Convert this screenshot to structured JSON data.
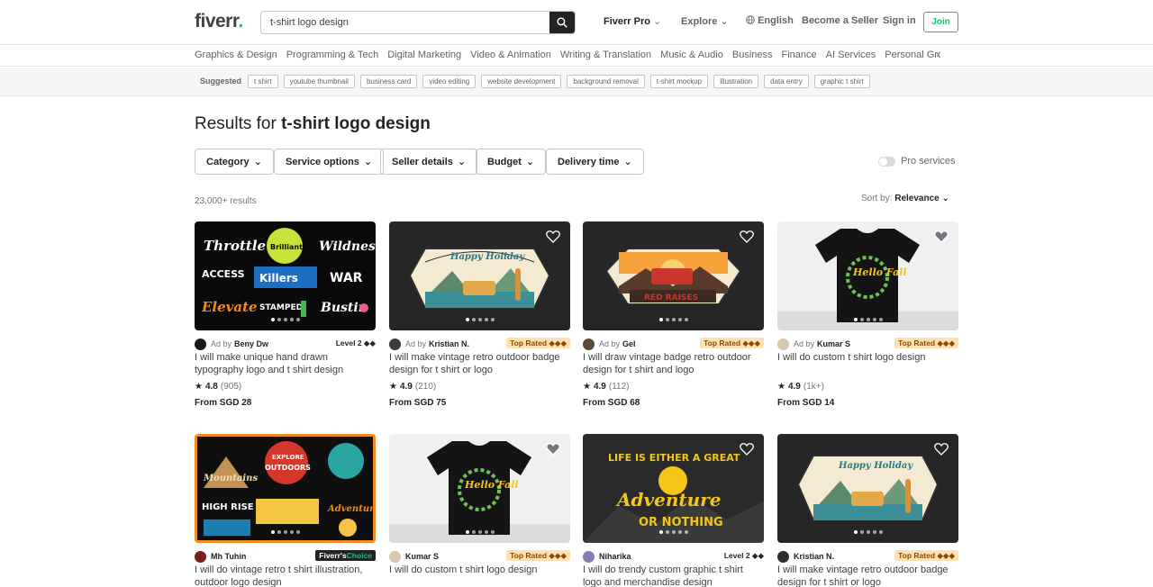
{
  "header": {
    "logo": "fiverr",
    "logo_dot": ".",
    "search_value": "t-shirt logo design",
    "nav": {
      "pro": "Fiverr Pro",
      "explore": "Explore",
      "language": "English",
      "become_seller": "Become a Seller",
      "sign_in": "Sign in",
      "join": "Join"
    }
  },
  "categories": [
    "Graphics & Design",
    "Programming & Tech",
    "Digital Marketing",
    "Video & Animation",
    "Writing & Translation",
    "Music & Audio",
    "Business",
    "Finance",
    "AI Services",
    "Personal Growth"
  ],
  "suggested": {
    "label": "Suggested",
    "tags": [
      "t shirt",
      "youtube thumbnail",
      "business card",
      "video editing",
      "website development",
      "background removal",
      "t-shirt mockup",
      "illustration",
      "data entry",
      "graphic t shirt"
    ]
  },
  "results": {
    "prefix": "Results for ",
    "query": "t-shirt logo design",
    "count": "23,000+ results",
    "sort_label": "Sort by:",
    "sort_value": "Relevance"
  },
  "filters": {
    "category": "Category",
    "service_options": "Service options",
    "seller_details": "Seller details",
    "budget": "Budget",
    "delivery_time": "Delivery time",
    "pro_services": "Pro services"
  },
  "gigs": [
    {
      "ad": "Ad by",
      "seller": "Beny Dw",
      "badge_type": "level",
      "badge": "Level 2 ◆◆",
      "title": "I will make unique hand drawn typography logo and t shirt design",
      "rating": "4.8",
      "reviews": "(905)",
      "price": "From SGD 28"
    },
    {
      "ad": "Ad by",
      "seller": "Kristian N.",
      "badge_type": "toprated",
      "badge": "Top Rated ◆◆◆",
      "title": "I will make vintage retro outdoor badge design for t shirt or logo",
      "rating": "4.9",
      "reviews": "(210)",
      "price": "From SGD 75"
    },
    {
      "ad": "Ad by",
      "seller": "Gel",
      "badge_type": "toprated",
      "badge": "Top Rated ◆◆◆",
      "title": "I will draw vintage badge retro outdoor design for t shirt and logo",
      "rating": "4.9",
      "reviews": "(112)",
      "price": "From SGD 68"
    },
    {
      "ad": "Ad by",
      "seller": "Kumar S",
      "badge_type": "toprated",
      "badge": "Top Rated ◆◆◆",
      "title": "I will do custom t shirt logo design",
      "rating": "4.9",
      "reviews": "(1k+)",
      "price": "From SGD 14"
    },
    {
      "ad": "",
      "seller": "Mh Tuhin",
      "badge_type": "choice",
      "badge_a": "Fiverr's",
      "badge_b": " Choice",
      "title": "I will do vintage retro t shirt illustration, outdoor logo design"
    },
    {
      "ad": "",
      "seller": "Kumar S",
      "badge_type": "toprated",
      "badge": "Top Rated ◆◆◆",
      "title": "I will do custom t shirt logo design"
    },
    {
      "ad": "",
      "seller": "Niharika",
      "badge_type": "level",
      "badge": "Level 2 ◆◆",
      "title": "I will do trendy custom graphic t shirt logo and merchandise design"
    },
    {
      "ad": "",
      "seller": "Kristian N.",
      "badge_type": "toprated",
      "badge": "Top Rated ◆◆◆",
      "title": "I will make vintage retro outdoor badge design for t shirt or logo"
    }
  ],
  "art": {
    "g1": [
      "Throttle",
      "Brilliant",
      "Wildness",
      "ACCESS",
      "Killers",
      "WAR",
      "Elevate",
      "STAMPED",
      "Bustin"
    ],
    "g2": "Happy Holiday",
    "g3": "RED RAISES",
    "g4": "Hello Fall",
    "g5": [
      "Mountains",
      "EXPLORE",
      "OUTDOORS",
      "HIGH RISE",
      "Adventure"
    ],
    "g6": "Hello Fall",
    "g7": [
      "LIFE IS EITHER A GREAT",
      "Adventure",
      "OR NOTHING"
    ],
    "g8": "Happy Holiday"
  },
  "colors": {
    "brand_green": "#1dbf73",
    "top_rated_bg": "#ffe0b3",
    "text": "#222325"
  }
}
